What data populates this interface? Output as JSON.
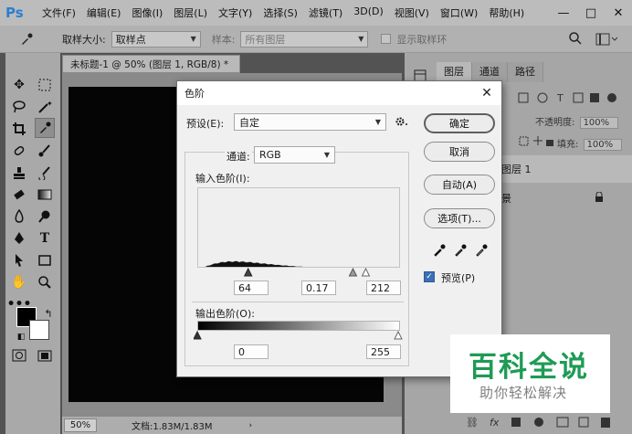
{
  "app": {
    "logo": "Ps"
  },
  "menu": [
    "文件(F)",
    "编辑(E)",
    "图像(I)",
    "图层(L)",
    "文字(Y)",
    "选择(S)",
    "滤镜(T)",
    "3D(D)",
    "视图(V)",
    "窗口(W)",
    "帮助(H)"
  ],
  "window_controls": {
    "minimize": "—",
    "maximize": "□",
    "close": "✕"
  },
  "options": {
    "sample_size_label": "取样大小:",
    "sample_size_value": "取样点",
    "sample_label": "样本:",
    "sample_value": "所有图层",
    "show_ring_label": "显示取样环"
  },
  "document": {
    "tab_title": "未标题-1 @ 50% (图层 1, RGB/8) *",
    "zoom": "50%",
    "doc_info": "文档:1.83M/1.83M"
  },
  "panels": {
    "tabs": [
      "图层",
      "通道",
      "路径"
    ],
    "opacity_label": "不透明度:",
    "opacity_value": "100%",
    "fill_label": "填充:",
    "fill_value": "100%",
    "layers": [
      {
        "name": "图层 1"
      },
      {
        "name": "景"
      }
    ]
  },
  "levels_dialog": {
    "title": "色阶",
    "close": "✕",
    "preset_label": "预设(E):",
    "preset_value": "自定",
    "channel_label": "通道:",
    "channel_value": "RGB",
    "input_levels_label": "输入色阶(I):",
    "input_black": "64",
    "input_gamma": "0.17",
    "input_white": "212",
    "input_black_fraction": 0.251,
    "input_white_fraction": 0.831,
    "output_levels_label": "输出色阶(O):",
    "output_black": "0",
    "output_white": "255",
    "buttons": {
      "ok": "确定",
      "cancel": "取消",
      "auto": "自动(A)",
      "options": "选项(T)..."
    },
    "preview_label": "预览(P)",
    "preview_checked": true
  },
  "watermark": {
    "line1": "百科全说",
    "line2": "助你轻松解决",
    "color": "#1e9b55"
  }
}
